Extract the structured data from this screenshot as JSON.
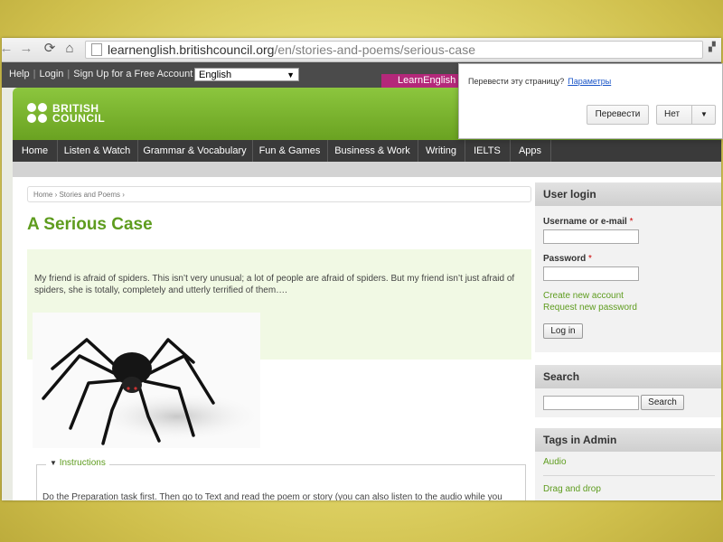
{
  "browser": {
    "url_host": "learnenglish.britishcouncil.org",
    "url_path": "/en/stories-and-poems/serious-case"
  },
  "topbar": {
    "help": "Help",
    "login": "Login",
    "signup": "Sign Up for a Free Account",
    "language": "English",
    "learnenglish_tab": "LearnEnglish T"
  },
  "logo": {
    "line1": "BRITISH",
    "line2": "COUNCIL"
  },
  "nav": {
    "items": [
      "Home",
      "Listen & Watch",
      "Grammar & Vocabulary",
      "Fun & Games",
      "Business & Work",
      "Writing",
      "IELTS",
      "Apps"
    ]
  },
  "breadcrumb": {
    "home": "Home",
    "sep1": " › ",
    "section": "Stories and Poems",
    "sep2": " ›"
  },
  "article": {
    "title": "A Serious Case",
    "intro": "My friend is afraid of spiders. This isn’t very unusual; a lot of people are afraid of spiders. But my friend isn’t just afraid of spiders, she is totally, completely and utterly terrified of them….",
    "instructions_legend": "Instructions",
    "instructions_text": "Do the Preparation task first. Then go to Text and read the poem or story (you can also listen to the audio while you"
  },
  "login_block": {
    "title": "User login",
    "username_label": "Username or e-mail",
    "password_label": "Password",
    "required_mark": "*",
    "create_account": "Create new account",
    "request_password": "Request new password",
    "login_button": "Log in"
  },
  "search_block": {
    "title": "Search",
    "button": "Search"
  },
  "tags_block": {
    "title": "Tags in Admin",
    "items": [
      "Audio",
      "Drag and drop"
    ]
  },
  "translate_popup": {
    "question": "Перевести эту страницу?",
    "options_link": "Параметры",
    "translate_button": "Перевести",
    "no_button": "Нет"
  },
  "colors": {
    "brand_green": "#6aa221",
    "title_green": "#5e9c1e",
    "learnenglish_pink": "#b4287a",
    "nav_dark": "#3a3a3a"
  }
}
